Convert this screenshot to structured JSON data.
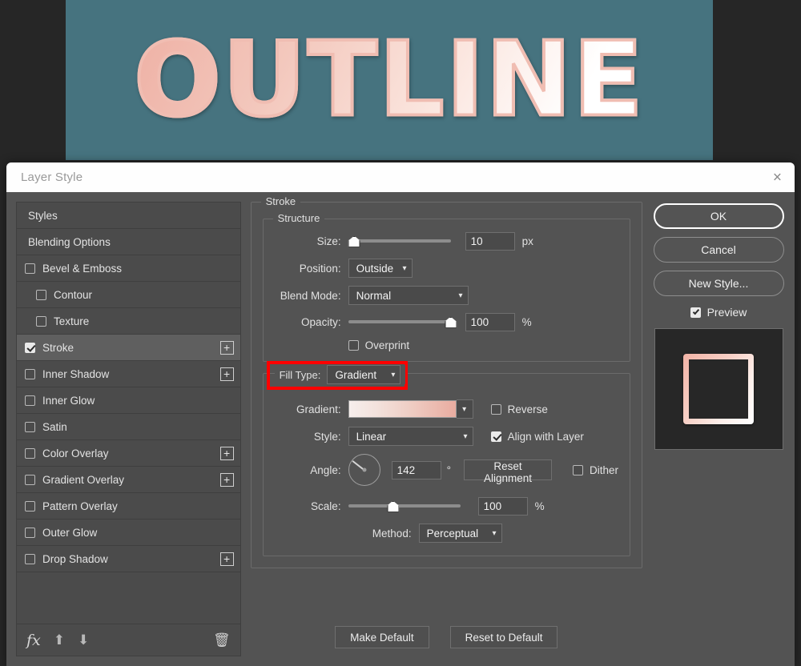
{
  "canvas": {
    "artwork_text": "OUTLINE",
    "background_color": "#46737f",
    "stroke_gradient_from": "#eeb0a4",
    "stroke_gradient_to": "#ffffff"
  },
  "titlebar": {
    "title": "Layer Style",
    "close_icon": "close-icon",
    "close_glyph": "×"
  },
  "styles_panel": {
    "items": [
      {
        "label": "Styles",
        "type": "plain",
        "checked": false,
        "has_plus": false,
        "indent": false,
        "selected": false
      },
      {
        "label": "Blending Options",
        "type": "plain",
        "checked": false,
        "has_plus": false,
        "indent": false,
        "selected": false
      },
      {
        "label": "Bevel & Emboss",
        "type": "check",
        "checked": false,
        "has_plus": false,
        "indent": false,
        "selected": false
      },
      {
        "label": "Contour",
        "type": "check",
        "checked": false,
        "has_plus": false,
        "indent": true,
        "selected": false
      },
      {
        "label": "Texture",
        "type": "check",
        "checked": false,
        "has_plus": false,
        "indent": true,
        "selected": false
      },
      {
        "label": "Stroke",
        "type": "check",
        "checked": true,
        "has_plus": true,
        "indent": false,
        "selected": true
      },
      {
        "label": "Inner Shadow",
        "type": "check",
        "checked": false,
        "has_plus": true,
        "indent": false,
        "selected": false
      },
      {
        "label": "Inner Glow",
        "type": "check",
        "checked": false,
        "has_plus": false,
        "indent": false,
        "selected": false
      },
      {
        "label": "Satin",
        "type": "check",
        "checked": false,
        "has_plus": false,
        "indent": false,
        "selected": false
      },
      {
        "label": "Color Overlay",
        "type": "check",
        "checked": false,
        "has_plus": true,
        "indent": false,
        "selected": false
      },
      {
        "label": "Gradient Overlay",
        "type": "check",
        "checked": false,
        "has_plus": true,
        "indent": false,
        "selected": false
      },
      {
        "label": "Pattern Overlay",
        "type": "check",
        "checked": false,
        "has_plus": false,
        "indent": false,
        "selected": false
      },
      {
        "label": "Outer Glow",
        "type": "check",
        "checked": false,
        "has_plus": false,
        "indent": false,
        "selected": false
      },
      {
        "label": "Drop Shadow",
        "type": "check",
        "checked": false,
        "has_plus": true,
        "indent": false,
        "selected": false
      }
    ],
    "footer": {
      "fx_label": "fx",
      "move_up_glyph": "⬆",
      "move_down_glyph": "⬇",
      "trash_glyph": "🗑"
    }
  },
  "stroke": {
    "legend": "Stroke",
    "structure": {
      "legend": "Structure",
      "size": {
        "label": "Size:",
        "value": "10",
        "unit": "px",
        "slider_pct": 6
      },
      "position": {
        "label": "Position:",
        "value": "Outside"
      },
      "blend_mode": {
        "label": "Blend Mode:",
        "value": "Normal"
      },
      "opacity": {
        "label": "Opacity:",
        "value": "100",
        "unit": "%",
        "slider_pct": 100
      },
      "overprint": {
        "label": "Overprint",
        "checked": false
      }
    },
    "fill_type": {
      "label": "Fill Type:",
      "value": "Gradient",
      "highlight_color": "#ff0000",
      "gradient": {
        "label": "Gradient:",
        "from_color": "#f6eeec",
        "to_color": "#e9aca0"
      },
      "reverse": {
        "label": "Reverse",
        "checked": false
      },
      "style": {
        "label": "Style:",
        "value": "Linear"
      },
      "align_with_layer": {
        "label": "Align with Layer",
        "checked": true
      },
      "angle": {
        "label": "Angle:",
        "value": "142",
        "unit": "°"
      },
      "reset_alignment_label": "Reset Alignment",
      "dither": {
        "label": "Dither",
        "checked": false
      },
      "scale": {
        "label": "Scale:",
        "value": "100",
        "unit": "%",
        "slider_pct": 40
      },
      "method": {
        "label": "Method:",
        "value": "Perceptual"
      }
    },
    "make_default_label": "Make Default",
    "reset_to_default_label": "Reset to Default"
  },
  "actions": {
    "ok_label": "OK",
    "cancel_label": "Cancel",
    "new_style_label": "New Style...",
    "preview": {
      "label": "Preview",
      "checked": true
    }
  }
}
